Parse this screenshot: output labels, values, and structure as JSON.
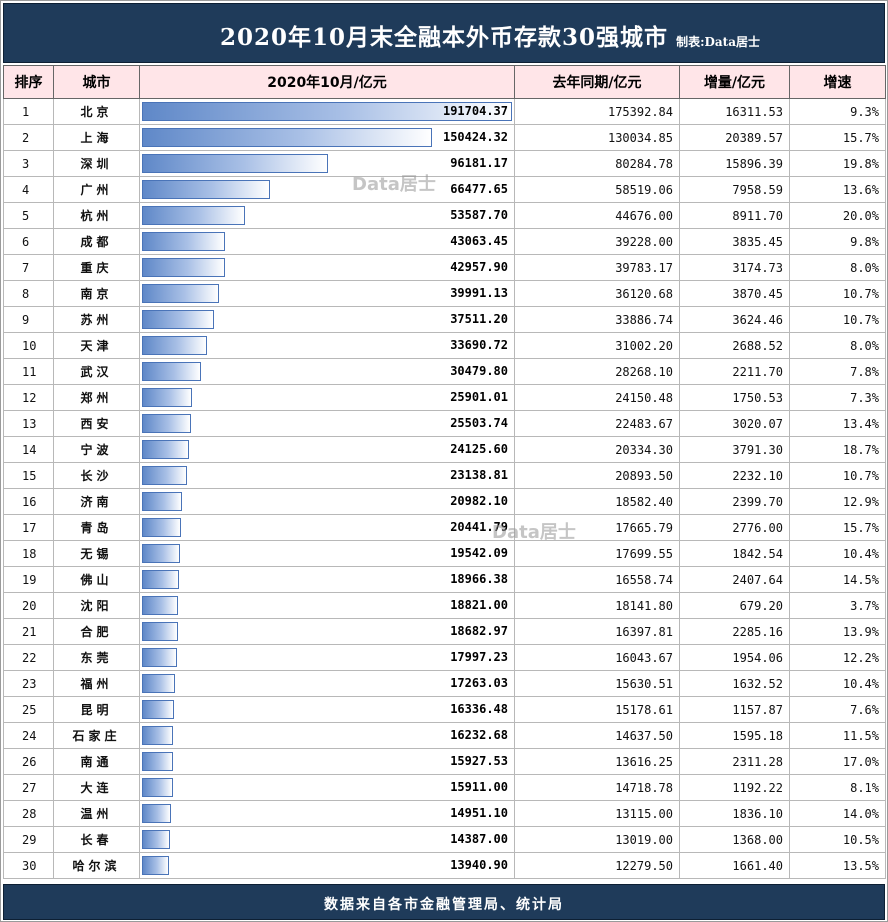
{
  "title": "2020年10月末全融本外币存款30强城市",
  "maker": "制表:Data居士",
  "footer": "数据来自各市金融管理局、统计局",
  "watermark": "Data居士",
  "colors": {
    "header_bg": "#1f3b5a",
    "column_header_bg": "#ffe5e8",
    "bar": "#5f88c8"
  },
  "columns": [
    "排序",
    "城市",
    "2020年10月/亿元",
    "去年同期/亿元",
    "增量/亿元",
    "增速"
  ],
  "chart_data": {
    "type": "table",
    "bar_column": "2020年10月/亿元",
    "bar_max": 191704.37,
    "rows": [
      {
        "rank": "1",
        "city": "北京",
        "current": "191704.37",
        "current_value": 191704.37,
        "last_year": "175392.84",
        "increase": "16311.53",
        "growth": "9.3%"
      },
      {
        "rank": "2",
        "city": "上海",
        "current": "150424.32",
        "current_value": 150424.32,
        "last_year": "130034.85",
        "increase": "20389.57",
        "growth": "15.7%"
      },
      {
        "rank": "3",
        "city": "深圳",
        "current": "96181.17",
        "current_value": 96181.17,
        "last_year": "80284.78",
        "increase": "15896.39",
        "growth": "19.8%"
      },
      {
        "rank": "4",
        "city": "广州",
        "current": "66477.65",
        "current_value": 66477.65,
        "last_year": "58519.06",
        "increase": "7958.59",
        "growth": "13.6%"
      },
      {
        "rank": "5",
        "city": "杭州",
        "current": "53587.70",
        "current_value": 53587.7,
        "last_year": "44676.00",
        "increase": "8911.70",
        "growth": "20.0%"
      },
      {
        "rank": "6",
        "city": "成都",
        "current": "43063.45",
        "current_value": 43063.45,
        "last_year": "39228.00",
        "increase": "3835.45",
        "growth": "9.8%"
      },
      {
        "rank": "7",
        "city": "重庆",
        "current": "42957.90",
        "current_value": 42957.9,
        "last_year": "39783.17",
        "increase": "3174.73",
        "growth": "8.0%"
      },
      {
        "rank": "8",
        "city": "南京",
        "current": "39991.13",
        "current_value": 39991.13,
        "last_year": "36120.68",
        "increase": "3870.45",
        "growth": "10.7%"
      },
      {
        "rank": "9",
        "city": "苏州",
        "current": "37511.20",
        "current_value": 37511.2,
        "last_year": "33886.74",
        "increase": "3624.46",
        "growth": "10.7%"
      },
      {
        "rank": "10",
        "city": "天津",
        "current": "33690.72",
        "current_value": 33690.72,
        "last_year": "31002.20",
        "increase": "2688.52",
        "growth": "8.0%"
      },
      {
        "rank": "11",
        "city": "武汉",
        "current": "30479.80",
        "current_value": 30479.8,
        "last_year": "28268.10",
        "increase": "2211.70",
        "growth": "7.8%"
      },
      {
        "rank": "12",
        "city": "郑州",
        "current": "25901.01",
        "current_value": 25901.01,
        "last_year": "24150.48",
        "increase": "1750.53",
        "growth": "7.3%"
      },
      {
        "rank": "13",
        "city": "西安",
        "current": "25503.74",
        "current_value": 25503.74,
        "last_year": "22483.67",
        "increase": "3020.07",
        "growth": "13.4%"
      },
      {
        "rank": "14",
        "city": "宁波",
        "current": "24125.60",
        "current_value": 24125.6,
        "last_year": "20334.30",
        "increase": "3791.30",
        "growth": "18.7%"
      },
      {
        "rank": "15",
        "city": "长沙",
        "current": "23138.81",
        "current_value": 23138.81,
        "last_year": "20893.50",
        "increase": "2232.10",
        "growth": "10.7%"
      },
      {
        "rank": "16",
        "city": "济南",
        "current": "20982.10",
        "current_value": 20982.1,
        "last_year": "18582.40",
        "increase": "2399.70",
        "growth": "12.9%"
      },
      {
        "rank": "17",
        "city": "青岛",
        "current": "20441.79",
        "current_value": 20441.79,
        "last_year": "17665.79",
        "increase": "2776.00",
        "growth": "15.7%"
      },
      {
        "rank": "18",
        "city": "无锡",
        "current": "19542.09",
        "current_value": 19542.09,
        "last_year": "17699.55",
        "increase": "1842.54",
        "growth": "10.4%"
      },
      {
        "rank": "19",
        "city": "佛山",
        "current": "18966.38",
        "current_value": 18966.38,
        "last_year": "16558.74",
        "increase": "2407.64",
        "growth": "14.5%"
      },
      {
        "rank": "20",
        "city": "沈阳",
        "current": "18821.00",
        "current_value": 18821.0,
        "last_year": "18141.80",
        "increase": "679.20",
        "growth": "3.7%"
      },
      {
        "rank": "21",
        "city": "合肥",
        "current": "18682.97",
        "current_value": 18682.97,
        "last_year": "16397.81",
        "increase": "2285.16",
        "growth": "13.9%"
      },
      {
        "rank": "22",
        "city": "东莞",
        "current": "17997.23",
        "current_value": 17997.23,
        "last_year": "16043.67",
        "increase": "1954.06",
        "growth": "12.2%"
      },
      {
        "rank": "23",
        "city": "福州",
        "current": "17263.03",
        "current_value": 17263.03,
        "last_year": "15630.51",
        "increase": "1632.52",
        "growth": "10.4%"
      },
      {
        "rank": "25",
        "city": "昆明",
        "current": "16336.48",
        "current_value": 16336.48,
        "last_year": "15178.61",
        "increase": "1157.87",
        "growth": "7.6%"
      },
      {
        "rank": "24",
        "city": "石家庄",
        "current": "16232.68",
        "current_value": 16232.68,
        "last_year": "14637.50",
        "increase": "1595.18",
        "growth": "11.5%"
      },
      {
        "rank": "26",
        "city": "南通",
        "current": "15927.53",
        "current_value": 15927.53,
        "last_year": "13616.25",
        "increase": "2311.28",
        "growth": "17.0%"
      },
      {
        "rank": "27",
        "city": "大连",
        "current": "15911.00",
        "current_value": 15911.0,
        "last_year": "14718.78",
        "increase": "1192.22",
        "growth": "8.1%"
      },
      {
        "rank": "28",
        "city": "温州",
        "current": "14951.10",
        "current_value": 14951.1,
        "last_year": "13115.00",
        "increase": "1836.10",
        "growth": "14.0%"
      },
      {
        "rank": "29",
        "city": "长春",
        "current": "14387.00",
        "current_value": 14387.0,
        "last_year": "13019.00",
        "increase": "1368.00",
        "growth": "10.5%"
      },
      {
        "rank": "30",
        "city": "哈尔滨",
        "current": "13940.90",
        "current_value": 13940.9,
        "last_year": "12279.50",
        "increase": "1661.40",
        "growth": "13.5%"
      }
    ]
  }
}
